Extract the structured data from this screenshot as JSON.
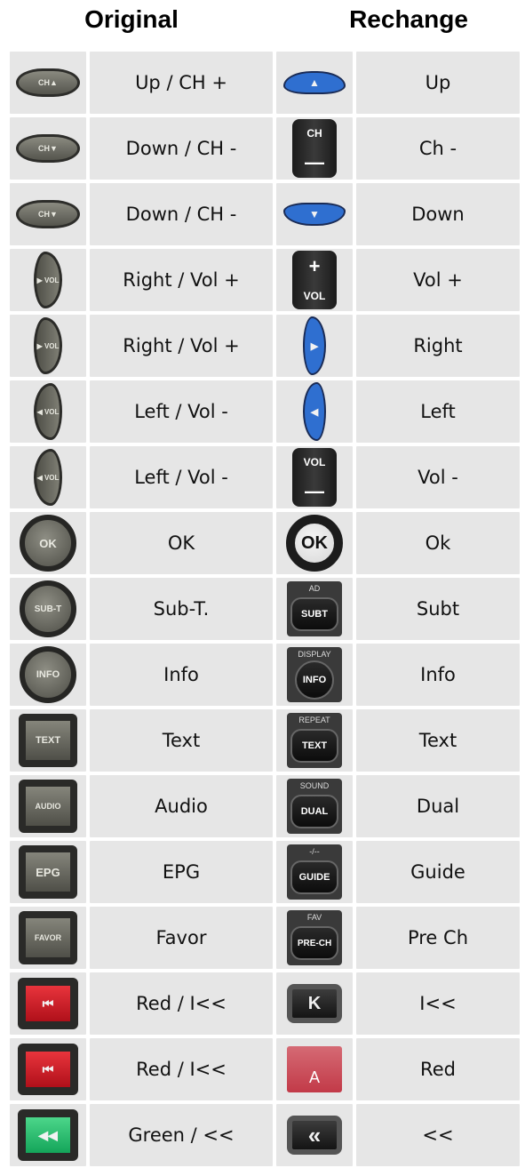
{
  "header": {
    "original_label": "Original",
    "rechange_label": "Rechange"
  },
  "rows": [
    {
      "orig_icon": "ch-up-icon",
      "orig_key": "CH▲",
      "orig_label": "Up / CH +",
      "new_icon": "blue-up-arrow-icon",
      "new_key": "▲",
      "new_label": "Up"
    },
    {
      "orig_icon": "ch-down-icon",
      "orig_key": "CH▼",
      "orig_label": "Down / CH -",
      "new_icon": "ch-minus-icon",
      "new_key": "CH",
      "new_label": "Ch -"
    },
    {
      "orig_icon": "ch-down-icon",
      "orig_key": "CH▼",
      "orig_label": "Down / CH -",
      "new_icon": "blue-down-arrow-icon",
      "new_key": "▼",
      "new_label": "Down"
    },
    {
      "orig_icon": "vol-right-icon",
      "orig_key": "▶ VOL",
      "orig_label": "Right / Vol +",
      "new_icon": "vol-plus-icon",
      "new_key": "VOL",
      "new_label": "Vol +"
    },
    {
      "orig_icon": "vol-right-icon",
      "orig_key": "▶ VOL",
      "orig_label": "Right / Vol +",
      "new_icon": "blue-right-arrow-icon",
      "new_key": "▶",
      "new_label": "Right"
    },
    {
      "orig_icon": "vol-left-icon",
      "orig_key": "◀ VOL",
      "orig_label": "Left / Vol -",
      "new_icon": "blue-left-arrow-icon",
      "new_key": "◀",
      "new_label": "Left"
    },
    {
      "orig_icon": "vol-left-icon",
      "orig_key": "◀ VOL",
      "orig_label": "Left / Vol -",
      "new_icon": "vol-minus-icon",
      "new_key": "VOL",
      "new_label": "Vol -"
    },
    {
      "orig_icon": "ok-icon",
      "orig_key": "OK",
      "orig_label": "OK",
      "new_icon": "ok-icon",
      "new_key": "OK",
      "new_label": "Ok"
    },
    {
      "orig_icon": "sub-t-icon",
      "orig_key": "SUB-T",
      "orig_label": "Sub-T.",
      "new_icon": "subt-icon",
      "new_top": "AD",
      "new_key": "SUBT",
      "new_label": "Subt"
    },
    {
      "orig_icon": "info-icon",
      "orig_key": "INFO",
      "orig_label": "Info",
      "new_icon": "info-icon",
      "new_top": "DISPLAY",
      "new_key": "INFO",
      "new_label": "Info"
    },
    {
      "orig_icon": "text-icon",
      "orig_key": "TEXT",
      "orig_label": "Text",
      "new_icon": "text-icon",
      "new_top": "REPEAT",
      "new_key": "TEXT",
      "new_label": "Text"
    },
    {
      "orig_icon": "audio-icon",
      "orig_key": "AUDIO",
      "orig_label": "Audio",
      "new_icon": "dual-icon",
      "new_top": "SOUND",
      "new_key": "DUAL",
      "new_label": "Dual"
    },
    {
      "orig_icon": "epg-icon",
      "orig_key": "EPG",
      "orig_label": "EPG",
      "new_icon": "guide-icon",
      "new_top": "-/--",
      "new_key": "GUIDE",
      "new_label": "Guide"
    },
    {
      "orig_icon": "favor-icon",
      "orig_key": "FAVOR",
      "orig_label": "Favor",
      "new_icon": "pre-ch-icon",
      "new_top": "FAV",
      "new_key": "PRE-CH",
      "new_label": "Pre Ch"
    },
    {
      "orig_icon": "red-prev-icon",
      "orig_key": "⏮",
      "orig_label": "Red / I<<",
      "new_icon": "prev-icon",
      "new_key": "K",
      "new_label": "I<<"
    },
    {
      "orig_icon": "red-prev-icon",
      "orig_key": "⏮",
      "orig_label": "Red / I<<",
      "new_icon": "red-a-icon",
      "new_key": "A",
      "new_label": "Red"
    },
    {
      "orig_icon": "green-rewind-icon",
      "orig_key": "◀◀",
      "orig_label": "Green / <<",
      "new_icon": "rewind-icon",
      "new_key": "«",
      "new_label": "<<"
    }
  ]
}
